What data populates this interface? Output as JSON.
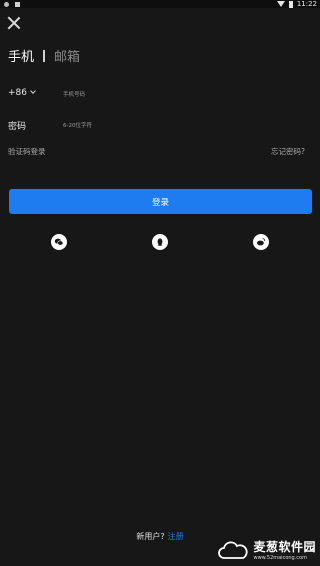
{
  "status_bar": {
    "time": "11:22"
  },
  "tabs": {
    "phone": "手机",
    "email": "邮箱"
  },
  "phone_row": {
    "country_code": "+86",
    "placeholder": "手机号码"
  },
  "password_row": {
    "label": "密码",
    "placeholder": "6-20位字符"
  },
  "links": {
    "sms_login": "验证码登录",
    "forgot_password": "忘记密码?"
  },
  "login_button": "登录",
  "social_logins": [
    "wechat-icon",
    "qq-icon",
    "weibo-icon"
  ],
  "footer": {
    "question": "新用户?",
    "register": "注册"
  },
  "watermark": {
    "title": "麦葱软件园",
    "url": "www.52maicong.com"
  },
  "colors": {
    "background": "#171717",
    "accent": "#1f7cf0"
  }
}
